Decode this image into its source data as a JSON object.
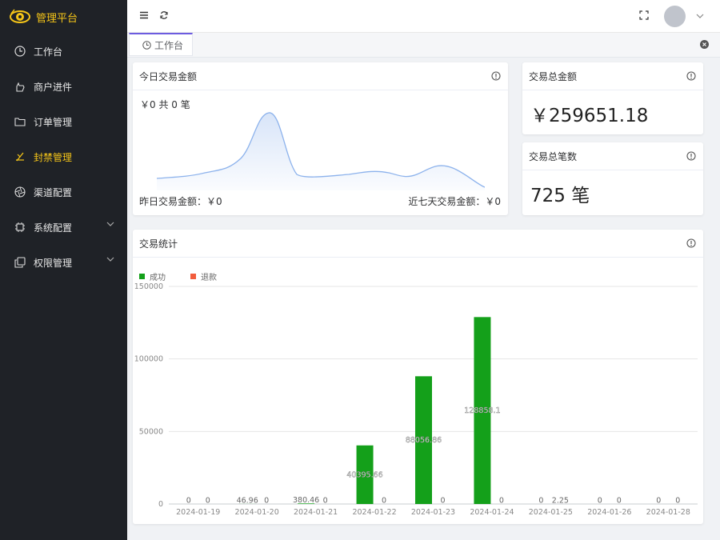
{
  "app": {
    "title": "管理平台"
  },
  "sidebar": {
    "items": [
      {
        "label": "工作台",
        "icon": "clock-icon"
      },
      {
        "label": "商户进件",
        "icon": "hand-icon"
      },
      {
        "label": "订单管理",
        "icon": "folder-icon"
      },
      {
        "label": "封禁管理",
        "icon": "ban-icon",
        "active": true
      },
      {
        "label": "渠道配置",
        "icon": "aperture-icon"
      },
      {
        "label": "系统配置",
        "icon": "chip-icon",
        "expandable": true
      },
      {
        "label": "权限管理",
        "icon": "copy-icon",
        "expandable": true
      }
    ]
  },
  "tags": {
    "active": "工作台"
  },
  "today": {
    "title": "今日交易金额",
    "summary": "￥0 共 0 笔",
    "yesterday": "昨日交易金额：￥0",
    "week": "近七天交易金额：￥0"
  },
  "total_amount": {
    "title": "交易总金额",
    "value": "￥259651.18"
  },
  "total_count": {
    "title": "交易总笔数",
    "value": "725 笔"
  },
  "stats": {
    "title": "交易统计"
  },
  "colors": {
    "success": "#14a01a",
    "refund": "#f25c3c",
    "accent": "#f5c518",
    "sidebar": "#1f2227"
  },
  "chart_data": {
    "type": "bar",
    "categories": [
      "2024-01-19",
      "2024-01-20",
      "2024-01-21",
      "2024-01-22",
      "2024-01-23",
      "2024-01-24",
      "2024-01-25",
      "2024-01-26",
      "2024-01-28"
    ],
    "series": [
      {
        "name": "成功",
        "values": [
          0,
          46.96,
          380.46,
          40395.66,
          88056.86,
          128858.1,
          0,
          0,
          0
        ],
        "labels": [
          "0",
          "46.96",
          "380.46",
          "40395.66",
          "88056.86",
          "128858.1",
          "0",
          "0",
          "0"
        ]
      },
      {
        "name": "退款",
        "values": [
          0,
          0,
          0,
          0,
          0,
          0,
          2.25,
          0,
          0
        ],
        "labels": [
          "0",
          "0",
          "0",
          "0",
          "0",
          "0",
          "2.25",
          "0",
          "0"
        ]
      }
    ],
    "yticks": [
      "0",
      "50000",
      "100000",
      "150000"
    ],
    "ylim": [
      0,
      150000
    ],
    "legend": "top-left",
    "grid": true
  }
}
